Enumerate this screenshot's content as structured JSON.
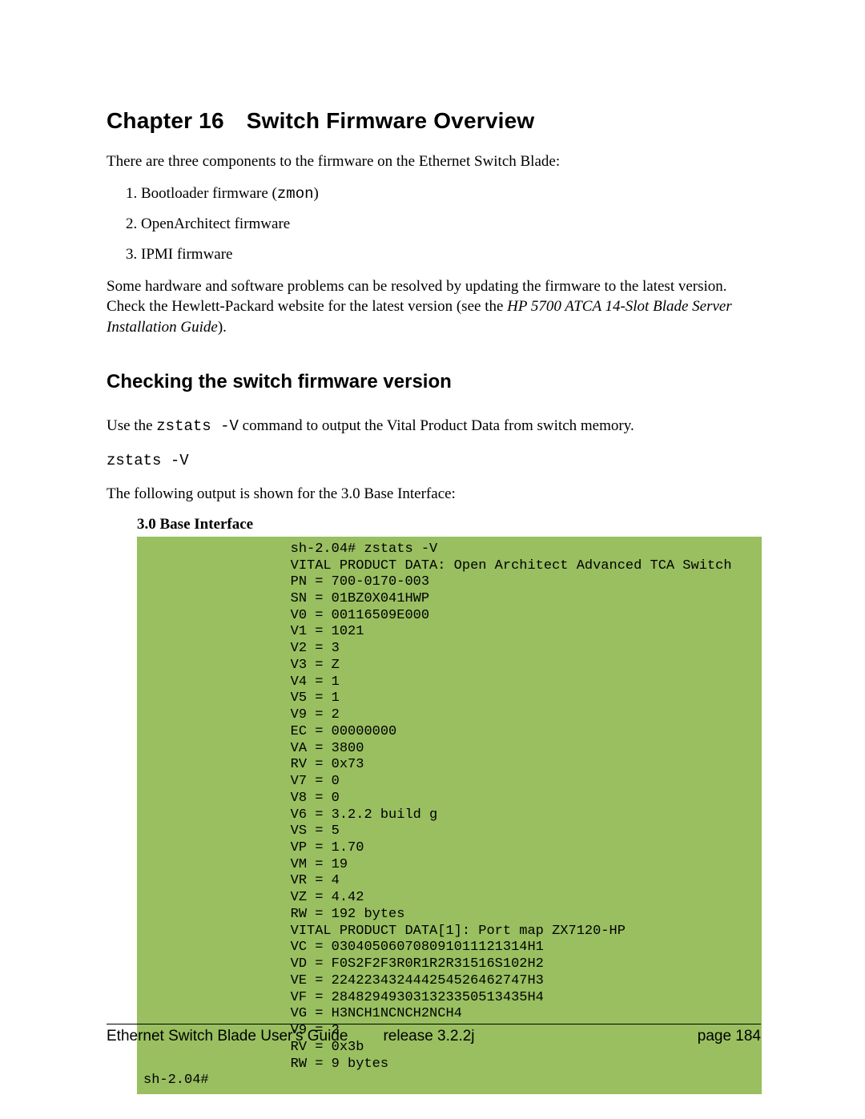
{
  "chapter": {
    "number_label": "Chapter 16",
    "title": "Switch Firmware Overview"
  },
  "intro_paragraph": "There are three components to the firmware on the Ethernet Switch Blade:",
  "list_items": {
    "item1_prefix": "1. Bootloader firmware (",
    "item1_code": "zmon",
    "item1_suffix": ")",
    "item2": "2. OpenArchitect firmware",
    "item3": "3. IPMI firmware"
  },
  "para2_part1": "Some hardware and software problems can be resolved by updating the firmware to the latest version. Check the Hewlett-Packard website for the latest version (see the ",
  "para2_italic": "HP 5700 ATCA 14-Slot Blade Server Installation Guide",
  "para2_part2": ").",
  "section_heading": "Checking the switch firmware version",
  "use_cmd_part1": "Use the ",
  "use_cmd_code": "zstats -V",
  "use_cmd_part2": " command to output the Vital Product Data from switch memory.",
  "cmd_display": "zstats -V",
  "output_para": "The following output is shown for the 3.0 Base Interface:",
  "subhead": "3.0 Base Interface",
  "terminal_text": "                  sh-2.04# zstats -V\n                  VITAL PRODUCT DATA: Open Architect Advanced TCA Switch\n                  PN = 700-0170-003\n                  SN = 01BZ0X041HWP\n                  V0 = 00116509E000\n                  V1 = 1021\n                  V2 = 3\n                  V3 = Z\n                  V4 = 1\n                  V5 = 1\n                  V9 = 2\n                  EC = 00000000\n                  VA = 3800\n                  RV = 0x73\n                  V7 = 0\n                  V8 = 0\n                  V6 = 3.2.2 build g\n                  VS = 5\n                  VP = 1.70\n                  VM = 19\n                  VR = 4\n                  VZ = 4.42\n                  RW = 192 bytes\n                  VITAL PRODUCT DATA[1]: Port map ZX7120-HP\n                  VC = 030405060708091011121314H1\n                  VD = F0S2F2F3R0R1R2R31516S102H2\n                  VE = 224223432444254526462747H3\n                  VF = 284829493031323350513435H4\n                  VG = H3NCH1NCNCH2NCH4\n                  V9 = 2\n                  RV = 0x3b\n                  RW = 9 bytes\nsh-2.04#",
  "footer": {
    "doc_title": "Ethernet Switch Blade User's Guide",
    "release": "release  3.2.2j",
    "page": "page 184"
  }
}
